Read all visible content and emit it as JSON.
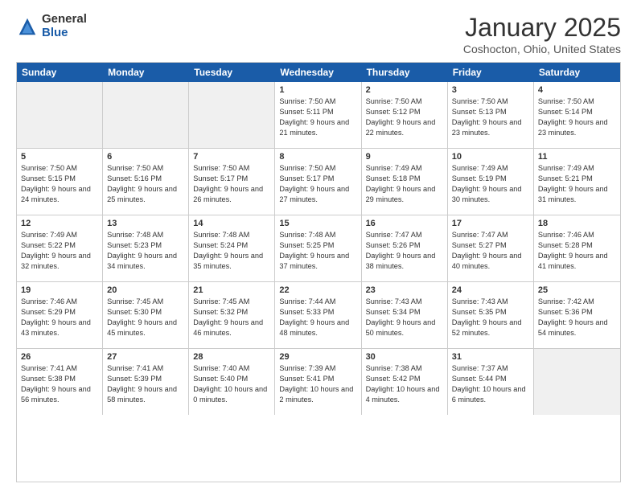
{
  "logo": {
    "general": "General",
    "blue": "Blue"
  },
  "title": "January 2025",
  "location": "Coshocton, Ohio, United States",
  "days_of_week": [
    "Sunday",
    "Monday",
    "Tuesday",
    "Wednesday",
    "Thursday",
    "Friday",
    "Saturday"
  ],
  "weeks": [
    [
      {
        "day": "",
        "sunrise": "",
        "sunset": "",
        "daylight": "",
        "shaded": true
      },
      {
        "day": "",
        "sunrise": "",
        "sunset": "",
        "daylight": "",
        "shaded": true
      },
      {
        "day": "",
        "sunrise": "",
        "sunset": "",
        "daylight": "",
        "shaded": true
      },
      {
        "day": "1",
        "sunrise": "Sunrise: 7:50 AM",
        "sunset": "Sunset: 5:11 PM",
        "daylight": "Daylight: 9 hours and 21 minutes.",
        "shaded": false
      },
      {
        "day": "2",
        "sunrise": "Sunrise: 7:50 AM",
        "sunset": "Sunset: 5:12 PM",
        "daylight": "Daylight: 9 hours and 22 minutes.",
        "shaded": false
      },
      {
        "day": "3",
        "sunrise": "Sunrise: 7:50 AM",
        "sunset": "Sunset: 5:13 PM",
        "daylight": "Daylight: 9 hours and 23 minutes.",
        "shaded": false
      },
      {
        "day": "4",
        "sunrise": "Sunrise: 7:50 AM",
        "sunset": "Sunset: 5:14 PM",
        "daylight": "Daylight: 9 hours and 23 minutes.",
        "shaded": false
      }
    ],
    [
      {
        "day": "5",
        "sunrise": "Sunrise: 7:50 AM",
        "sunset": "Sunset: 5:15 PM",
        "daylight": "Daylight: 9 hours and 24 minutes.",
        "shaded": false
      },
      {
        "day": "6",
        "sunrise": "Sunrise: 7:50 AM",
        "sunset": "Sunset: 5:16 PM",
        "daylight": "Daylight: 9 hours and 25 minutes.",
        "shaded": false
      },
      {
        "day": "7",
        "sunrise": "Sunrise: 7:50 AM",
        "sunset": "Sunset: 5:17 PM",
        "daylight": "Daylight: 9 hours and 26 minutes.",
        "shaded": false
      },
      {
        "day": "8",
        "sunrise": "Sunrise: 7:50 AM",
        "sunset": "Sunset: 5:17 PM",
        "daylight": "Daylight: 9 hours and 27 minutes.",
        "shaded": false
      },
      {
        "day": "9",
        "sunrise": "Sunrise: 7:49 AM",
        "sunset": "Sunset: 5:18 PM",
        "daylight": "Daylight: 9 hours and 29 minutes.",
        "shaded": false
      },
      {
        "day": "10",
        "sunrise": "Sunrise: 7:49 AM",
        "sunset": "Sunset: 5:19 PM",
        "daylight": "Daylight: 9 hours and 30 minutes.",
        "shaded": false
      },
      {
        "day": "11",
        "sunrise": "Sunrise: 7:49 AM",
        "sunset": "Sunset: 5:21 PM",
        "daylight": "Daylight: 9 hours and 31 minutes.",
        "shaded": false
      }
    ],
    [
      {
        "day": "12",
        "sunrise": "Sunrise: 7:49 AM",
        "sunset": "Sunset: 5:22 PM",
        "daylight": "Daylight: 9 hours and 32 minutes.",
        "shaded": false
      },
      {
        "day": "13",
        "sunrise": "Sunrise: 7:48 AM",
        "sunset": "Sunset: 5:23 PM",
        "daylight": "Daylight: 9 hours and 34 minutes.",
        "shaded": false
      },
      {
        "day": "14",
        "sunrise": "Sunrise: 7:48 AM",
        "sunset": "Sunset: 5:24 PM",
        "daylight": "Daylight: 9 hours and 35 minutes.",
        "shaded": false
      },
      {
        "day": "15",
        "sunrise": "Sunrise: 7:48 AM",
        "sunset": "Sunset: 5:25 PM",
        "daylight": "Daylight: 9 hours and 37 minutes.",
        "shaded": false
      },
      {
        "day": "16",
        "sunrise": "Sunrise: 7:47 AM",
        "sunset": "Sunset: 5:26 PM",
        "daylight": "Daylight: 9 hours and 38 minutes.",
        "shaded": false
      },
      {
        "day": "17",
        "sunrise": "Sunrise: 7:47 AM",
        "sunset": "Sunset: 5:27 PM",
        "daylight": "Daylight: 9 hours and 40 minutes.",
        "shaded": false
      },
      {
        "day": "18",
        "sunrise": "Sunrise: 7:46 AM",
        "sunset": "Sunset: 5:28 PM",
        "daylight": "Daylight: 9 hours and 41 minutes.",
        "shaded": false
      }
    ],
    [
      {
        "day": "19",
        "sunrise": "Sunrise: 7:46 AM",
        "sunset": "Sunset: 5:29 PM",
        "daylight": "Daylight: 9 hours and 43 minutes.",
        "shaded": false
      },
      {
        "day": "20",
        "sunrise": "Sunrise: 7:45 AM",
        "sunset": "Sunset: 5:30 PM",
        "daylight": "Daylight: 9 hours and 45 minutes.",
        "shaded": false
      },
      {
        "day": "21",
        "sunrise": "Sunrise: 7:45 AM",
        "sunset": "Sunset: 5:32 PM",
        "daylight": "Daylight: 9 hours and 46 minutes.",
        "shaded": false
      },
      {
        "day": "22",
        "sunrise": "Sunrise: 7:44 AM",
        "sunset": "Sunset: 5:33 PM",
        "daylight": "Daylight: 9 hours and 48 minutes.",
        "shaded": false
      },
      {
        "day": "23",
        "sunrise": "Sunrise: 7:43 AM",
        "sunset": "Sunset: 5:34 PM",
        "daylight": "Daylight: 9 hours and 50 minutes.",
        "shaded": false
      },
      {
        "day": "24",
        "sunrise": "Sunrise: 7:43 AM",
        "sunset": "Sunset: 5:35 PM",
        "daylight": "Daylight: 9 hours and 52 minutes.",
        "shaded": false
      },
      {
        "day": "25",
        "sunrise": "Sunrise: 7:42 AM",
        "sunset": "Sunset: 5:36 PM",
        "daylight": "Daylight: 9 hours and 54 minutes.",
        "shaded": false
      }
    ],
    [
      {
        "day": "26",
        "sunrise": "Sunrise: 7:41 AM",
        "sunset": "Sunset: 5:38 PM",
        "daylight": "Daylight: 9 hours and 56 minutes.",
        "shaded": false
      },
      {
        "day": "27",
        "sunrise": "Sunrise: 7:41 AM",
        "sunset": "Sunset: 5:39 PM",
        "daylight": "Daylight: 9 hours and 58 minutes.",
        "shaded": false
      },
      {
        "day": "28",
        "sunrise": "Sunrise: 7:40 AM",
        "sunset": "Sunset: 5:40 PM",
        "daylight": "Daylight: 10 hours and 0 minutes.",
        "shaded": false
      },
      {
        "day": "29",
        "sunrise": "Sunrise: 7:39 AM",
        "sunset": "Sunset: 5:41 PM",
        "daylight": "Daylight: 10 hours and 2 minutes.",
        "shaded": false
      },
      {
        "day": "30",
        "sunrise": "Sunrise: 7:38 AM",
        "sunset": "Sunset: 5:42 PM",
        "daylight": "Daylight: 10 hours and 4 minutes.",
        "shaded": false
      },
      {
        "day": "31",
        "sunrise": "Sunrise: 7:37 AM",
        "sunset": "Sunset: 5:44 PM",
        "daylight": "Daylight: 10 hours and 6 minutes.",
        "shaded": false
      },
      {
        "day": "",
        "sunrise": "",
        "sunset": "",
        "daylight": "",
        "shaded": true
      }
    ]
  ]
}
